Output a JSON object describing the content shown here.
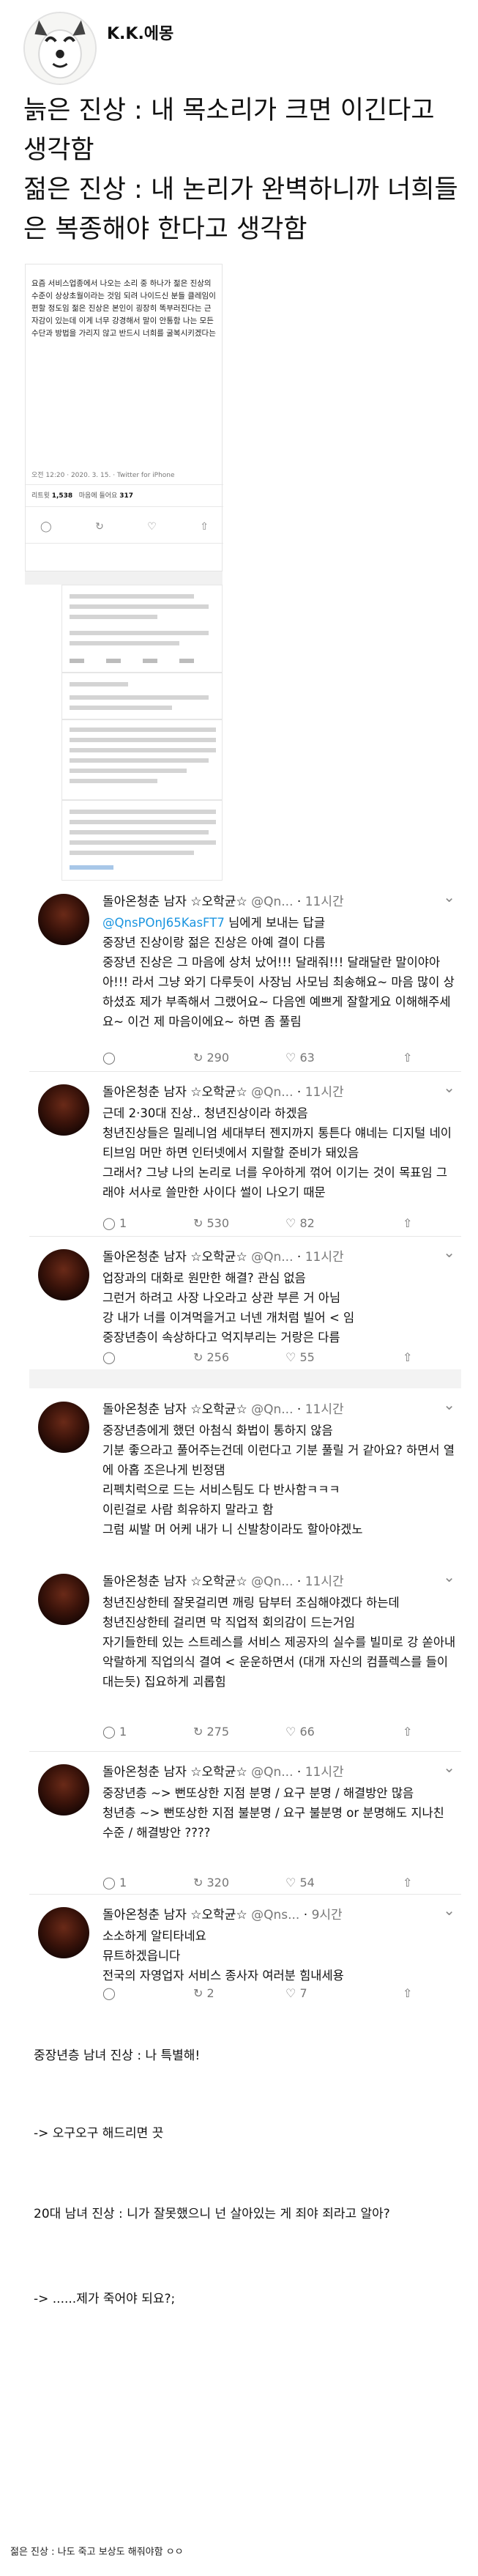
{
  "post": {
    "author": "K.K.에몽",
    "line1": "늙은 진상 : 내 목소리가 크면 이긴다고 생각함",
    "line2": "젊은 진상 : 내 논리가 완벽하니까 너희들은 복종해야 한다고 생각함"
  },
  "quote": {
    "body": "요즘 서비스업종에서 나오는 소리 중 하나가 젊은 진상의 수준이 상상초월이라는 것임 되려 나이드신 분들 클레임이 편할 정도임 젊은 진상은 본인이 굉장히 똑부러진다는 근자감이 있는데 이게 너무 강경해서 말이 안통함 나는 모든 수단과 방법을 가리지 않고 반드시 너희를 굴복시키겠다는",
    "meta": "오전 12:20 · 2020. 3. 15. · Twitter for iPhone",
    "retweets_label": "리트윗",
    "retweets": "1,538",
    "likes_label": "마음에 들어요",
    "likes": "317"
  },
  "thread": {
    "author": "돌아온청춘 남자 ☆오학균☆",
    "replies": [
      {
        "handle": "@Qn...",
        "time": "11시간",
        "mention": "@QnsPOnJ65KasFT7",
        "mention_suffix": "님에게 보내는 답글",
        "text": "중장년 진상이랑 젊은 진상은 아예 결이 다름\n중장년 진상은 그 마음에 상처 났어!!! 달래줘!!! 달래달란 말이야아아!!! 라서 그냥 와기 다루듯이 사장님 사모님 최송해요~ 마음 많이 상하셨죠 제가 부족해서 그랬어요~ 다음엔 예쁘게 잘할게요 이해해주세요~ 이건 제 마음이에요~ 하면 좀 풀림",
        "replies": "",
        "retweets": "290",
        "likes": "63"
      },
      {
        "handle": "@Qn...",
        "time": "11시간",
        "text": "근데 2·30대 진상.. 청년진상이라 하겠음\n청년진상들은 밀레니엄 세대부터 젠지까지 통튼다 얘네는 디지털 네이티브임 머만 하면 인터넷에서 지랄할 준비가 돼있음\n그래서? 그냥 나의 논리로 너를 우아하게 꺾어 이기는 것이 목표임 그래야 서사로 쓸만한 사이다 썰이 나오기 때문",
        "replies": "1",
        "retweets": "530",
        "likes": "82"
      },
      {
        "handle": "@Qn...",
        "time": "11시간",
        "text": "업장과의 대화로 원만한 해결? 관심 없음\n그런거 하려고 사장 나오라고 상관 부른 거 아님\n강 내가 너를 이겨먹을거고 너넨 개처럼 빌어 < 임\n중장년층이 속상하다고 억지부리는 거랑은 다름",
        "replies": "",
        "retweets": "256",
        "likes": "55"
      },
      {
        "handle": "@Qn...",
        "time": "11시간",
        "text": "중장년층에게 했던 아첨식 화법이 통하지 않음\n기분 좋으라고 풀어주는건데 이런다고 기분 풀릴 거 같아요? 하면서 열에 아홉 조은나게 빈정댐\n리펙치럭으로 드는 서비스팀도 다 반사함ㅋㅋㅋ\n이린걸로 사람 희유하지 말라고 함\n그럼 씨발 머 어케 내가 니 신발창이라도 할아야겠노",
        "replies": "",
        "retweets": "",
        "likes": ""
      },
      {
        "handle": "@Qn...",
        "time": "11시간",
        "text": "청년진상한테 잘못걸리면 깨링 담부터 조심해야겠다 하는데\n청년진상한테 걸리면 막 직업적 회의감이 드는거임\n자기들한테 있는 스트레스를 서비스 제공자의 실수를 빌미로 강 쏟아내 악랄하게 직업의식 결여 < 운운하면서 (대개 자신의 컴플렉스를 들이대는듯) 집요하게 괴롭힘",
        "replies": "1",
        "retweets": "275",
        "likes": "66"
      },
      {
        "handle": "@Qn...",
        "time": "11시간",
        "text": "중장년층 ~> 뻔또상한 지점 분명 / 요구 분명 / 해결방안 많음\n청년층 ~> 뻔또상한 지점 불분명 / 요구 불분명 or 분명해도 지나친 수준 / 해결방안 ????",
        "replies": "1",
        "retweets": "320",
        "likes": "54"
      },
      {
        "handle": "@Qns...",
        "time": "9시간",
        "text": "소소하게 알티타네요\n뮤트하겠읍니다\n전국의 자영업자 서비스 종사자 여러분 힘내세용",
        "replies": "",
        "retweets": "2",
        "likes": "7"
      }
    ]
  },
  "bottom": {
    "l1": "중장년층 남녀 진상 : 나 특별해!",
    "l2": "-> 오구오구 해드리면 끗",
    "l3": "20대 남녀 진상 : 니가 잘못했으니 넌 살아있는 게 죄야 죄라고 알아?",
    "l4": "-> ......제가 죽어야 되요?;",
    "footer": "젊은 진상 : 나도 죽고 보상도 해줘야함 ㅇㅇ"
  }
}
